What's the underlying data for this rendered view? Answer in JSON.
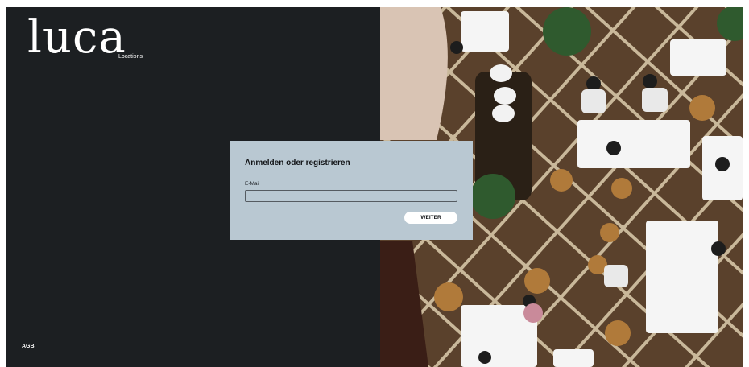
{
  "brand": {
    "logo_text": "luca",
    "subtitle": "Locations"
  },
  "footer": {
    "agb_link": "AGB"
  },
  "login": {
    "title": "Anmelden oder registrieren",
    "email_label": "E-Mail",
    "email_value": "",
    "email_placeholder": "",
    "submit_label": "WEITER"
  },
  "colors": {
    "left_panel_bg": "#1c1f22",
    "card_bg": "#b9c8d2",
    "text_white": "#ffffff",
    "text_dark": "#121417"
  },
  "icons": {
    "hero_image": "restaurant-overhead-photo"
  }
}
